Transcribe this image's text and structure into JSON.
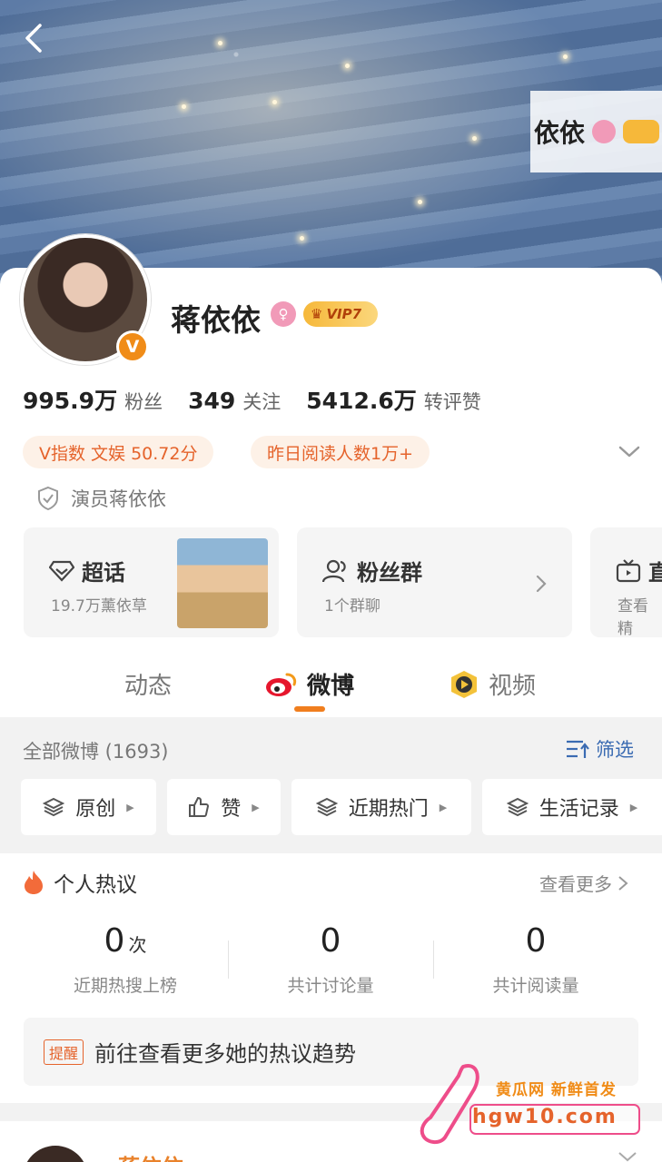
{
  "mini_header": {
    "name": "依依"
  },
  "profile": {
    "name": "蒋依依",
    "verified_mark": "V",
    "vip_label": "VIP7"
  },
  "stats": [
    {
      "value": "995.9万",
      "label": "粉丝"
    },
    {
      "value": "349",
      "label": "关注"
    },
    {
      "value": "5412.6万",
      "label": "转评赞"
    }
  ],
  "tags": [
    "V指数 文娱 50.72分",
    "昨日阅读人数1万+"
  ],
  "certification": "演员蒋依依",
  "feature_cards": {
    "supertopic": {
      "title": "超话",
      "subtitle": "19.7万薰依草"
    },
    "fan_group": {
      "title": "粉丝群",
      "subtitle": "1个群聊"
    },
    "live": {
      "title": "直",
      "subtitle": "查看精"
    }
  },
  "tabs": [
    {
      "label": "动态",
      "active": false
    },
    {
      "label": "微博",
      "active": true
    },
    {
      "label": "视频",
      "active": false
    }
  ],
  "feed_filter": {
    "all_count": "全部微博 (1693)",
    "filter_label": "筛选",
    "chips": [
      "原创",
      "赞",
      "近期热门",
      "生活记录"
    ]
  },
  "hot_discussion": {
    "title": "个人热议",
    "see_more": "查看更多",
    "metrics": [
      {
        "value": "0",
        "unit": "次",
        "label": "近期热搜上榜"
      },
      {
        "value": "0",
        "unit": "",
        "label": "共计讨论量"
      },
      {
        "value": "0",
        "unit": "",
        "label": "共计阅读量"
      }
    ],
    "reminder_tag": "提醒",
    "reminder_text": "前往查看更多她的热议趋势"
  },
  "next_post": {
    "author": "蒋依依"
  },
  "watermark": {
    "brand": "黄瓜网 新鲜首发",
    "url": "hgw10.com"
  },
  "colors": {
    "accent_orange": "#f07e1e",
    "link_blue": "#3a6bb2",
    "tag_bg": "#fdf1e7",
    "tag_text": "#e5632b"
  }
}
